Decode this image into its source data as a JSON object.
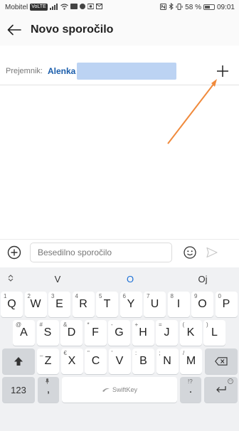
{
  "status_bar": {
    "carrier": "Mobitel",
    "battery": "58 %",
    "battery_level": 0.58,
    "time": "09:01"
  },
  "header": {
    "title": "Novo sporočilo",
    "back_icon": "arrow-left-icon"
  },
  "recipient": {
    "label": "Prejemnik:",
    "name": "Alenka"
  },
  "compose": {
    "placeholder": "Besedilno sporočilo"
  },
  "keyboard": {
    "suggestions": [
      "V",
      "O",
      "Oj"
    ],
    "rows": [
      {
        "keys": [
          {
            "main": "Q",
            "sub": "1"
          },
          {
            "main": "W",
            "sub": "2"
          },
          {
            "main": "E",
            "sub": "3"
          },
          {
            "main": "R",
            "sub": "4"
          },
          {
            "main": "T",
            "sub": "5"
          },
          {
            "main": "Y",
            "sub": "6"
          },
          {
            "main": "U",
            "sub": "7"
          },
          {
            "main": "I",
            "sub": "8"
          },
          {
            "main": "O",
            "sub": "9"
          },
          {
            "main": "P",
            "sub": "0"
          }
        ]
      },
      {
        "keys": [
          {
            "main": "A",
            "sub": "@"
          },
          {
            "main": "S",
            "sub": "#"
          },
          {
            "main": "D",
            "sub": "&"
          },
          {
            "main": "F",
            "sub": "*"
          },
          {
            "main": "G",
            "sub": "-"
          },
          {
            "main": "H",
            "sub": "+"
          },
          {
            "main": "J",
            "sub": "="
          },
          {
            "main": "K",
            "sub": "("
          },
          {
            "main": "L",
            "sub": ")"
          }
        ]
      },
      {
        "keys": [
          {
            "main": "Z",
            "sub": "_"
          },
          {
            "main": "X",
            "sub": "€"
          },
          {
            "main": "C",
            "sub": "\""
          },
          {
            "main": "V",
            "sub": "'"
          },
          {
            "main": "B",
            "sub": ":"
          },
          {
            "main": "N",
            "sub": ";"
          },
          {
            "main": "M",
            "sub": "/"
          }
        ]
      }
    ],
    "numbers_key": "123",
    "comma_key": ",",
    "period_key": ".",
    "space_brand": "SwiftKey"
  },
  "colors": {
    "accent": "#1a6fd6",
    "recipient_name": "#1a5dab",
    "annotation_arrow": "#f08a3c"
  }
}
